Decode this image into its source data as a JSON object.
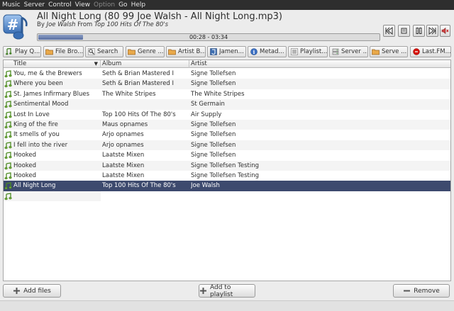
{
  "menu": [
    "Music",
    "Server",
    "Control",
    "View",
    "Option",
    "Go",
    "Help"
  ],
  "menu_disabled": "Option",
  "now_playing": {
    "title": "All Night Long (80 99 Joe Walsh - All Night Long.mp3)",
    "by_label": "By",
    "artist": "Joe Walsh",
    "from_label": "From",
    "album": "Top 100 Hits Of The 80's",
    "time": "00:28 - 03:34",
    "progress": 0.131
  },
  "controls": [
    "previous-icon",
    "stop-icon",
    "pause-icon",
    "next-icon",
    "volume-icon"
  ],
  "tabs": [
    {
      "label": "Play Q...",
      "icon": "play-queue-icon"
    },
    {
      "label": "File Bro...",
      "icon": "folder-icon"
    },
    {
      "label": "Search",
      "icon": "search-icon"
    },
    {
      "label": "Genre ...",
      "icon": "folder-icon"
    },
    {
      "label": "Artist B...",
      "icon": "folder-icon"
    },
    {
      "label": "Jamen...",
      "icon": "jamendo-icon"
    },
    {
      "label": "Metad...",
      "icon": "info-icon"
    },
    {
      "label": "Playlist...",
      "icon": "playlist-icon"
    },
    {
      "label": "Server ...",
      "icon": "server-icon"
    },
    {
      "label": "Serve ...",
      "icon": "folder-icon"
    },
    {
      "label": "Last.FM...",
      "icon": "lastfm-icon"
    }
  ],
  "table": {
    "columns": [
      "Title",
      "Album",
      "Artist"
    ],
    "rows": [
      {
        "title": "You, me & the Brewers",
        "album": "Seth & Brian Mastered I",
        "artist": "Signe Tollefsen"
      },
      {
        "title": "Where you been",
        "album": "Seth & Brian Mastered I",
        "artist": "Signe Tollefsen"
      },
      {
        "title": "St. James Infirmary Blues",
        "album": "The White Stripes",
        "artist": "The White Stripes"
      },
      {
        "title": "Sentimental Mood",
        "album": "",
        "artist": "St Germain"
      },
      {
        "title": "Lost In Love",
        "album": "Top 100 Hits Of The 80's",
        "artist": "Air Supply"
      },
      {
        "title": "King of the fire",
        "album": "Maus opnames",
        "artist": "Signe Tollefsen"
      },
      {
        "title": "It smells of you",
        "album": "Arjo opnames",
        "artist": "Signe Tollefsen"
      },
      {
        "title": "I fell into the river",
        "album": "Arjo opnames",
        "artist": "Signe Tollefsen"
      },
      {
        "title": "Hooked",
        "album": "Laatste Mixen",
        "artist": "Signe Tollefsen"
      },
      {
        "title": "Hooked",
        "album": "Laatste Mixen",
        "artist": "Signe Tollefsen Testing"
      },
      {
        "title": "Hooked",
        "album": "Laatste Mixen",
        "artist": "Signe Tollefsen Testing"
      },
      {
        "title": "All Night Long",
        "album": "Top 100 Hits Of The 80's",
        "artist": "Joe Walsh"
      },
      {
        "title": "",
        "album": "",
        "artist": ""
      }
    ],
    "selected_index": 11
  },
  "buttons": {
    "add_files": "Add files",
    "add_to_playlist": "Add to playlist",
    "remove": "Remove"
  },
  "colors": {
    "selection": "#3d4a6e",
    "progress": "#5b70a3",
    "menubar": "#2e2e2e"
  }
}
